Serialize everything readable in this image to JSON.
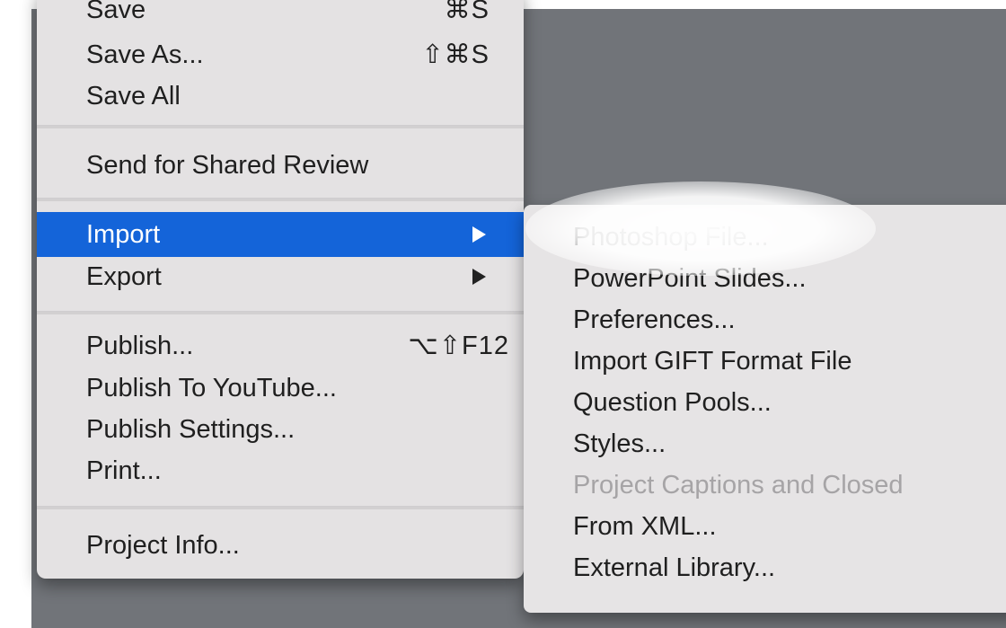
{
  "menu": {
    "items": [
      {
        "label": "Save",
        "shortcut": "⌘S"
      },
      {
        "label": "Save As...",
        "shortcut": "⇧⌘S"
      },
      {
        "label": "Save All",
        "shortcut": ""
      },
      {
        "label": "Send for Shared Review",
        "shortcut": ""
      },
      {
        "label": "Import",
        "shortcut": ""
      },
      {
        "label": "Export",
        "shortcut": ""
      },
      {
        "label": "Publish...",
        "shortcut": "⌥⇧F12"
      },
      {
        "label": "Publish To YouTube...",
        "shortcut": ""
      },
      {
        "label": "Publish Settings...",
        "shortcut": ""
      },
      {
        "label": "Print...",
        "shortcut": ""
      },
      {
        "label": "Project Info...",
        "shortcut": ""
      }
    ]
  },
  "submenu": {
    "items": [
      {
        "label": "Photoshop File...",
        "enabled": true
      },
      {
        "label": "PowerPoint Slides...",
        "enabled": true
      },
      {
        "label": "Preferences...",
        "enabled": true
      },
      {
        "label": "Import GIFT Format File",
        "enabled": true
      },
      {
        "label": "Question Pools...",
        "enabled": true
      },
      {
        "label": "Styles...",
        "enabled": true
      },
      {
        "label": "Project Captions and Closed",
        "enabled": false
      },
      {
        "label": "From XML...",
        "enabled": true
      },
      {
        "label": "External Library...",
        "enabled": true
      }
    ]
  },
  "colors": {
    "backdrop": "#717479",
    "menu_bg": "#e4e2e3",
    "highlight": "#1464d9",
    "disabled_text": "#a6a4a6"
  },
  "icons": {
    "submenu_arrow": "triangle-right"
  }
}
